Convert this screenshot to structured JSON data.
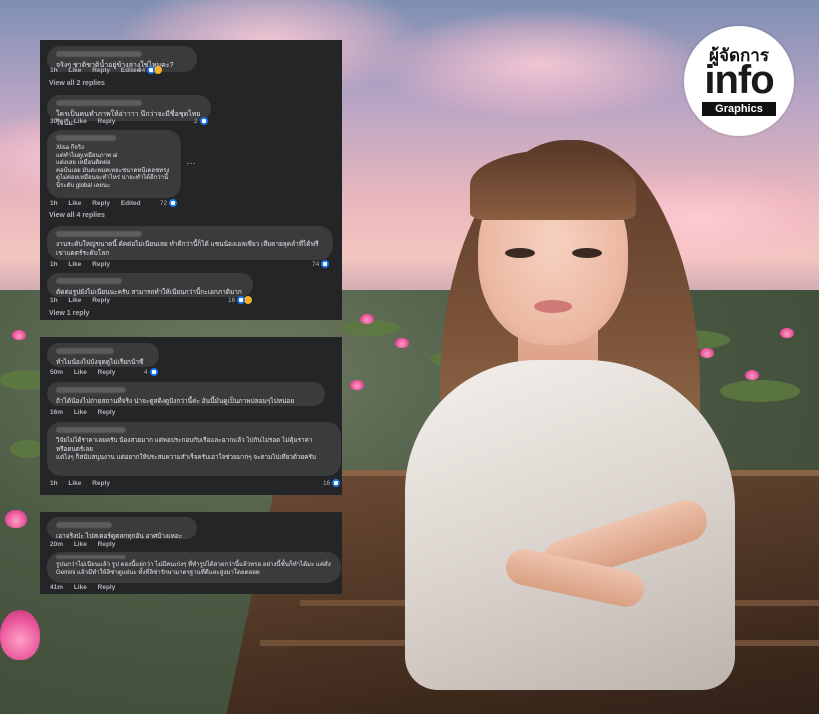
{
  "logo": {
    "top": "ผู้จัดการ",
    "main": "info",
    "sub": "Graphics"
  },
  "meta_labels": {
    "like": "Like",
    "reply": "Reply",
    "edited": "Edited"
  },
  "comments": [
    {
      "text": "จริงๆ ชาติชาติน้ำอยู่ข้างล่างใช่ไหมคะ?",
      "time": "1h",
      "edited": true,
      "reactions": "44",
      "view_replies": "View all 2 replies"
    },
    {
      "text": "ใครเป็นคนทำภาพให้อ่าาาา นึกว่าจะมีชื่อชุดไทยใจนึ่ม:",
      "time": "30m",
      "edited": false,
      "reactions": "2"
    },
    {
      "text": "Xlisa กีจริง\nแต่ทำไมดูเหมือนภาพ ai\nแต่งเลย เหมือนติดต่อ\nคอบ้นเอย มันสะหมดเหอะชนาดหนีเดลชทรง\nดูไม่ค่อยเหมือนจะทำไหร่ น่าจะทำได้อีกว่านี้\nนี่ระดับ global เลยนะ",
      "time": "1h",
      "edited": true,
      "reactions": "72",
      "view_replies": "View all 4 replies"
    },
    {
      "text": "งานระดับใหญ่ขนาดนี้ ดัดต่อไม่เนียนเลย ทำดีกว่านี้ก็ได้ แชนน้องเอลเซียว เสียดายลุคลำที่ได้ฟรี\nเขาแดตร์ระดับโลก",
      "time": "1h",
      "edited": false,
      "reactions": "74"
    },
    {
      "text": "ตัดต่อรูปยังไม่เนียนนะครับ สามารถทำให้เนียนกว่านี้กะเอกภาติมาก",
      "time": "1h",
      "edited": false,
      "reactions": "16",
      "view_replies": "View 1 reply"
    },
    {
      "text": "ทำไมน้องไปบังจุดดูไม่เรียกน้าซี",
      "time": "50m",
      "edited": false,
      "reactions": "4"
    },
    {
      "text": "ถ้าได้น้องไปถ่ายสถานที่จริง น่าจะดูสติงดูปังกว่านี้ค่ะ อันนี้มันดูเป็นภาพปลอมๆไปหน่อย",
      "time": "16m",
      "edited": false,
      "reactions": ""
    },
    {
      "text": "วิจัยไม่ได้ราคาเลยครับ น้องสวยมาก แต่พอประกอบกับเรือและฉากแล้ว ไปกันไม่รอด ไม่คุ้มราคา\nหรือดนตร์เลย\nแต่ไงๆ ก็สนับสนุนงาน แต่อยากให้ประสบความสำเร็จครับเอาใจช่วยมากๆ จะตามไปเที่ยวด้วยครับ",
      "time": "1h",
      "edited": false,
      "reactions": "16"
    },
    {
      "text": "เอาจริงป่ะ ไปสเตอร์ดูตลกทุกอัน อาศบ้างเหอะ",
      "time": "20m",
      "edited": false,
      "reactions": ""
    },
    {
      "text": "รูปนกว่าไม่เนียนแล้ว รูป ตองนี้แย่กว่า ไม่มีคนเก่งๆ ที่ทำรูปได้สวยกว่านี้แล้วหรอ อย่างนี้ชั้นก็ทำได้มะ แค่สั่ง Gemini แล้วมีทำให้ลิซ่าดูแย่นะ ทั้งที่ลิซ่ารักษามาตรฐานที่ดีและสูงมาโดยตลอด",
      "time": "41m",
      "edited": false,
      "reactions": ""
    }
  ]
}
